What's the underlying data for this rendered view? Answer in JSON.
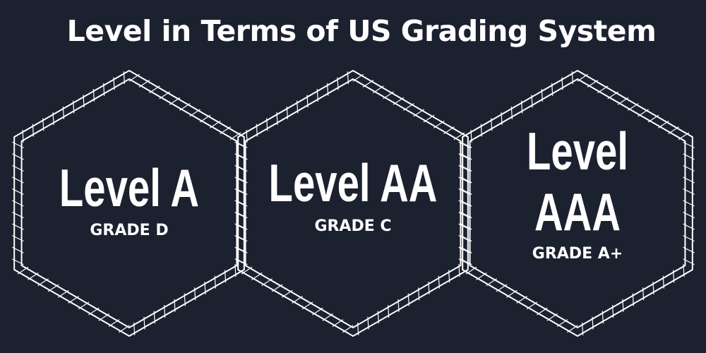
{
  "title": "Level in Terms of US Grading System",
  "levels": [
    {
      "lines": [
        "Level A"
      ],
      "grade": "GRADE D"
    },
    {
      "lines": [
        "Level AA"
      ],
      "grade": "GRADE C"
    },
    {
      "lines": [
        "Level",
        "AAA"
      ],
      "grade": "GRADE A+"
    }
  ],
  "colors": {
    "background": "#1c2130",
    "foreground": "#ffffff"
  }
}
